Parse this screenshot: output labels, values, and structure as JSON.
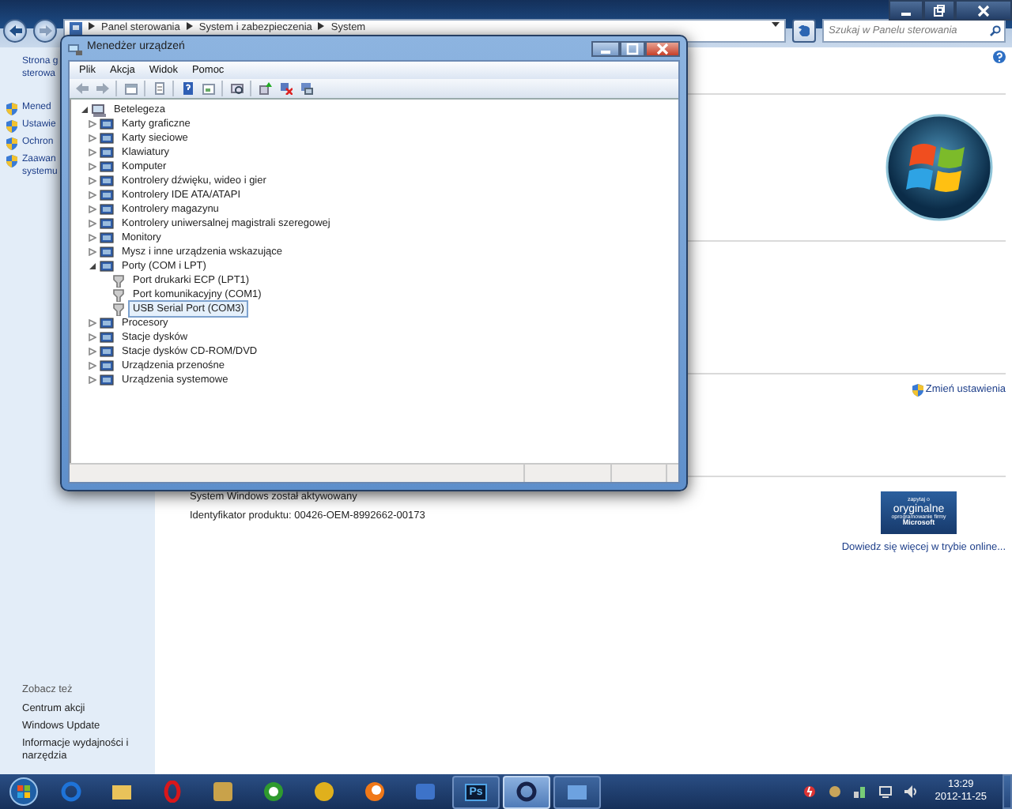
{
  "control_panel": {
    "breadcrumb": [
      "Panel sterowania",
      "System i zabezpieczenia",
      "System"
    ],
    "search": {
      "placeholder": "Szukaj w Panelu sterowania"
    },
    "sidebar": {
      "home": {
        "lines": [
          "Strona g",
          "sterowa"
        ]
      },
      "links": [
        {
          "lines": [
            "Mened"
          ]
        },
        {
          "lines": [
            "Ustawie"
          ]
        },
        {
          "lines": [
            "Ochron"
          ]
        },
        {
          "lines": [
            "Zaawan",
            "systemu"
          ]
        }
      ],
      "see_also": {
        "heading": "Zobacz też",
        "links": [
          "Centrum akcji",
          "Windows Update",
          "Informacje wydajności i narzędzia"
        ]
      }
    },
    "content": {
      "change_settings": "Zmień ustawienia",
      "activation": "System Windows został aktywowany",
      "product_id": "Identyfikator produktu: 00426-OEM-8992662-00173",
      "badge": [
        "zapytaj o",
        "oryginalne",
        "oprogramowanie firmy",
        "Microsoft"
      ],
      "learn_more": "Dowiedz się więcej w trybie online..."
    }
  },
  "device_manager": {
    "title": "Menedżer urządzeń",
    "menu": [
      "Plik",
      "Akcja",
      "Widok",
      "Pomoc"
    ],
    "tree": {
      "label": "Betelegeza",
      "expanded": true,
      "selected": false,
      "children": [
        {
          "label": "Karty graficzne",
          "expanded": false,
          "selected": false
        },
        {
          "label": "Karty sieciowe",
          "expanded": false,
          "selected": false
        },
        {
          "label": "Klawiatury",
          "expanded": false,
          "selected": false
        },
        {
          "label": "Komputer",
          "expanded": false,
          "selected": false
        },
        {
          "label": "Kontrolery dźwięku, wideo i gier",
          "expanded": false,
          "selected": false
        },
        {
          "label": "Kontrolery IDE ATA/ATAPI",
          "expanded": false,
          "selected": false
        },
        {
          "label": "Kontrolery magazynu",
          "expanded": false,
          "selected": false
        },
        {
          "label": "Kontrolery uniwersalnej magistrali szeregowej",
          "expanded": false,
          "selected": false
        },
        {
          "label": "Monitory",
          "expanded": false,
          "selected": false
        },
        {
          "label": "Mysz i inne urządzenia wskazujące",
          "expanded": false,
          "selected": false
        },
        {
          "label": "Porty (COM i LPT)",
          "expanded": true,
          "selected": false,
          "children": [
            {
              "label": "Port drukarki ECP (LPT1)",
              "selected": false
            },
            {
              "label": "Port komunikacyjny (COM1)",
              "selected": false
            },
            {
              "label": "USB Serial Port (COM3)",
              "selected": true
            }
          ]
        },
        {
          "label": "Procesory",
          "expanded": false,
          "selected": false
        },
        {
          "label": "Stacje dysków",
          "expanded": false,
          "selected": false
        },
        {
          "label": "Stacje dysków CD-ROM/DVD",
          "expanded": false,
          "selected": false
        },
        {
          "label": "Urządzenia przenośne",
          "expanded": false,
          "selected": false
        },
        {
          "label": "Urządzenia systemowe",
          "expanded": false,
          "selected": false
        }
      ]
    }
  },
  "taskbar": {
    "apps": [
      {
        "open": false,
        "selected": false
      },
      {
        "open": false,
        "selected": false
      },
      {
        "open": false,
        "selected": false
      },
      {
        "open": false,
        "selected": false
      },
      {
        "open": false,
        "selected": false
      },
      {
        "open": false,
        "selected": false
      },
      {
        "open": false,
        "selected": false
      },
      {
        "open": false,
        "selected": false
      },
      {
        "open": true,
        "selected": false,
        "label": "Ps"
      },
      {
        "open": true,
        "selected": true
      },
      {
        "open": true,
        "selected": false
      }
    ],
    "time": "13:29",
    "date": "2012-11-25"
  }
}
